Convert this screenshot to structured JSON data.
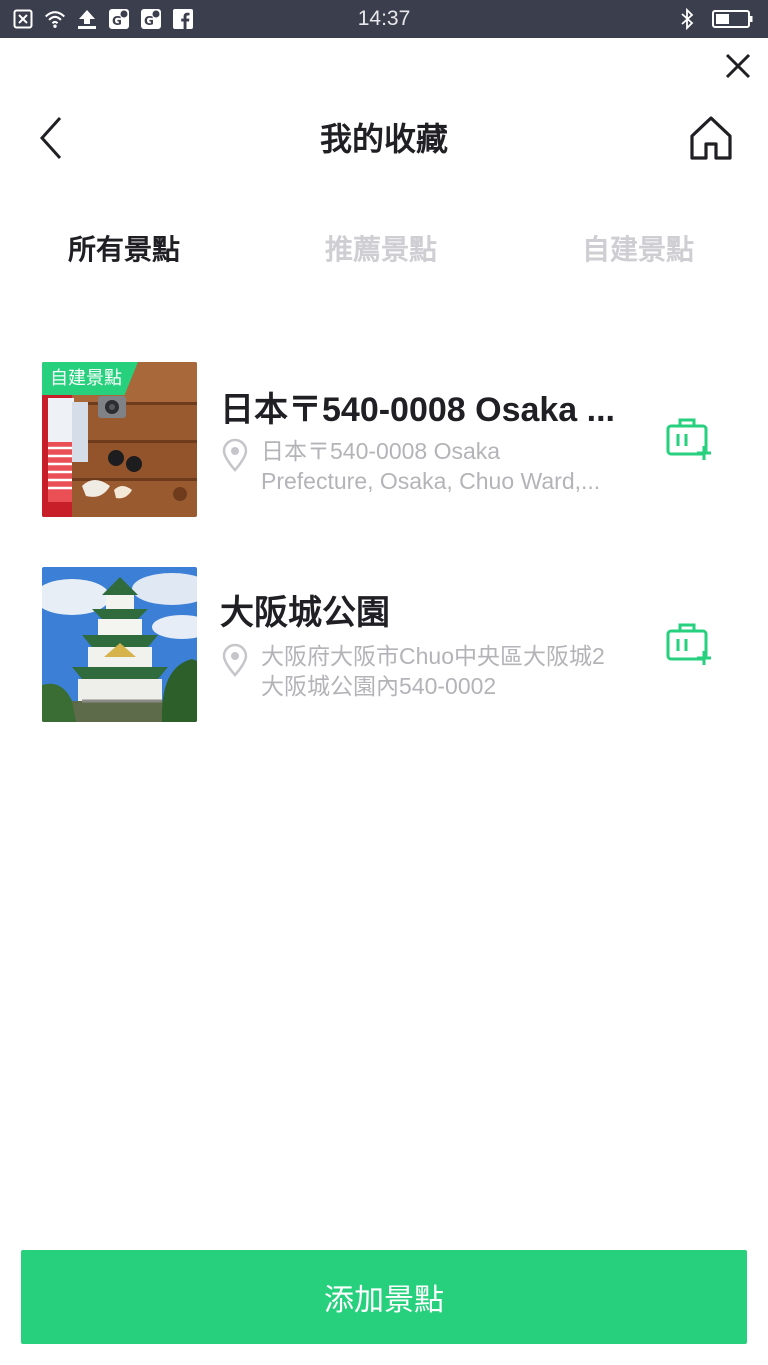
{
  "status_bar": {
    "time": "14:37",
    "left_icons": [
      "close-box-icon",
      "wifi-icon",
      "upload-icon",
      "maps-icon",
      "maps-icon",
      "facebook-icon"
    ],
    "right_icons": [
      "bluetooth-icon",
      "battery-icon"
    ]
  },
  "header": {
    "title": "我的收藏"
  },
  "tabs": [
    {
      "label": "所有景點",
      "active": true
    },
    {
      "label": "推薦景點",
      "active": false
    },
    {
      "label": "自建景點",
      "active": false
    }
  ],
  "items": [
    {
      "badge": "自建景點",
      "title": "日本〒540-0008 Osaka ...",
      "address_line1": "日本〒540-0008 Osaka",
      "address_line2": "Prefecture, Osaka, Chuo Ward,..."
    },
    {
      "badge": "",
      "title": "大阪城公園",
      "address_line1": "大阪府大阪市Chuo中央區大阪城2",
      "address_line2": "大阪城公園內540-0002"
    }
  ],
  "bottom_button": {
    "label": "添加景點"
  },
  "colors": {
    "accent": "#26d07c",
    "status_bar_bg": "#3b3e4c",
    "inactive_tab": "#cfcfd3",
    "address_text": "#b4b4b8"
  }
}
